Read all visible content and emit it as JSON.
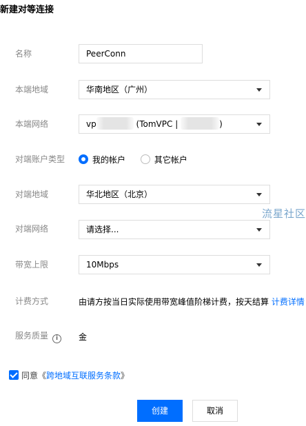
{
  "dialog": {
    "title": "新建对等连接"
  },
  "form": {
    "name": {
      "label": "名称",
      "value": "PeerConn"
    },
    "local_region": {
      "label": "本端地域",
      "value": "华南地区（广州）"
    },
    "local_network": {
      "label": "本端网络",
      "value_prefix": "vp",
      "value_middle": "(TomVPC |",
      "value_suffix": ")"
    },
    "peer_account_type": {
      "label": "对端账户类型",
      "options": [
        {
          "label": "我的帐户",
          "selected": true
        },
        {
          "label": "其它帐户",
          "selected": false
        }
      ]
    },
    "peer_region": {
      "label": "对端地域",
      "value": "华北地区（北京）"
    },
    "peer_network": {
      "label": "对端网络",
      "value": "请选择..."
    },
    "bandwidth": {
      "label": "带宽上限",
      "value": "10Mbps"
    },
    "billing": {
      "label": "计费方式",
      "text": "由请方按当日实际使用带宽峰值阶梯计费，按天结算",
      "link": "计费详情"
    },
    "quality": {
      "label": "服务质量",
      "value": "金"
    }
  },
  "agreement": {
    "prefix": "同意《",
    "link": "跨地域互联服务条款",
    "suffix": "》",
    "checked": true
  },
  "actions": {
    "create_label": "创建",
    "cancel_label": "取消"
  },
  "watermark": {
    "text": "流星社区"
  },
  "colors": {
    "primary": "#006eff",
    "label": "#888888",
    "border": "#dddddd"
  }
}
